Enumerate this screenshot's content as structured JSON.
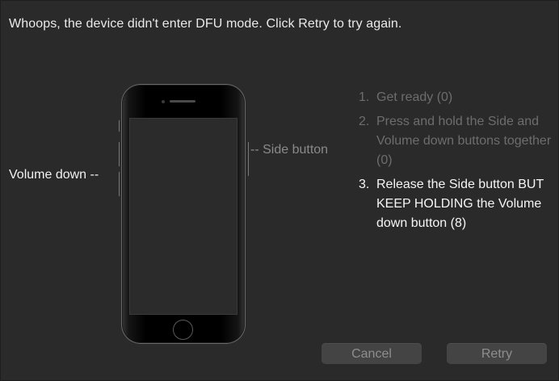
{
  "dialog": {
    "message": "Whoops, the device didn't enter DFU mode. Click Retry to try again."
  },
  "illustration": {
    "side_label": "-- Side button",
    "volume_label": "Volume down --"
  },
  "steps": [
    {
      "number": "1.",
      "text": "Get ready (0)",
      "state": "done"
    },
    {
      "number": "2.",
      "text": "Press and hold the Side and Volume down buttons together (0)",
      "state": "done"
    },
    {
      "number": "3.",
      "text": "Release the Side button BUT KEEP HOLDING the Volume down button (8)",
      "state": "active"
    }
  ],
  "buttons": {
    "cancel": "Cancel",
    "retry": "Retry"
  },
  "colors": {
    "background": "#2a2a2a",
    "active_text": "#f5f5f5",
    "dim_text": "#6d6d6d",
    "button_bg": "#444444"
  }
}
